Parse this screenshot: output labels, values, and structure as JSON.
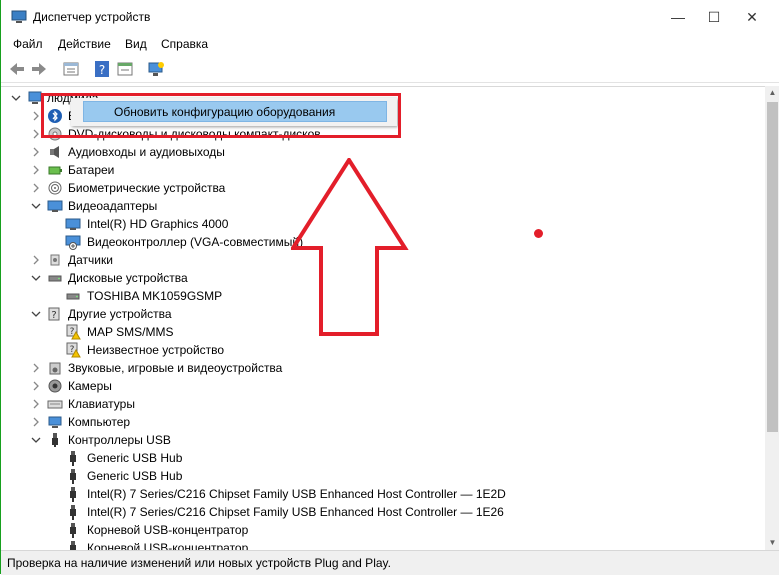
{
  "window": {
    "title": "Диспетчер устройств",
    "controls": {
      "minimize": "—",
      "maximize": "☐",
      "close": "✕"
    }
  },
  "menu": [
    "Файл",
    "Действие",
    "Вид",
    "Справка"
  ],
  "tree": {
    "root": "людмила",
    "items": [
      {
        "label": "Bluetooth",
        "indent": 1,
        "expander": "collapsed",
        "icon": "bluetooth-icon"
      },
      {
        "label": "DVD-дисководы и дисководы компакт-дисков",
        "indent": 1,
        "expander": "collapsed",
        "icon": "dvd-drive-icon"
      },
      {
        "label": "Аудиовходы и аудиовыходы",
        "indent": 1,
        "expander": "collapsed",
        "icon": "audio-icon"
      },
      {
        "label": "Батареи",
        "indent": 1,
        "expander": "collapsed",
        "icon": "battery-icon"
      },
      {
        "label": "Биометрические устройства",
        "indent": 1,
        "expander": "collapsed",
        "icon": "fingerprint-icon"
      },
      {
        "label": "Видеоадаптеры",
        "indent": 1,
        "expander": "expanded",
        "icon": "display-adapter-icon"
      },
      {
        "label": "Intel(R) HD Graphics 4000",
        "indent": 2,
        "expander": "none",
        "icon": "display-adapter-icon"
      },
      {
        "label": "Видеоконтроллер (VGA-совместимый)",
        "indent": 2,
        "expander": "none",
        "icon": "display-adapter-warning-icon"
      },
      {
        "label": "Датчики",
        "indent": 1,
        "expander": "collapsed",
        "icon": "sensor-icon"
      },
      {
        "label": "Дисковые устройства",
        "indent": 1,
        "expander": "expanded",
        "icon": "disk-icon"
      },
      {
        "label": "TOSHIBA MK1059GSMP",
        "indent": 2,
        "expander": "none",
        "icon": "disk-icon"
      },
      {
        "label": "Другие устройства",
        "indent": 1,
        "expander": "expanded",
        "icon": "unknown-device-icon"
      },
      {
        "label": "MAP SMS/MMS",
        "indent": 2,
        "expander": "none",
        "icon": "unknown-device-warning-icon"
      },
      {
        "label": "Неизвестное устройство",
        "indent": 2,
        "expander": "none",
        "icon": "unknown-device-warning-icon"
      },
      {
        "label": "Звуковые, игровые и видеоустройства",
        "indent": 1,
        "expander": "collapsed",
        "icon": "speaker-icon"
      },
      {
        "label": "Камеры",
        "indent": 1,
        "expander": "collapsed",
        "icon": "camera-icon"
      },
      {
        "label": "Клавиатуры",
        "indent": 1,
        "expander": "collapsed",
        "icon": "keyboard-icon"
      },
      {
        "label": "Компьютер",
        "indent": 1,
        "expander": "collapsed",
        "icon": "computer-icon"
      },
      {
        "label": "Контроллеры USB",
        "indent": 1,
        "expander": "expanded",
        "icon": "usb-icon"
      },
      {
        "label": "Generic USB Hub",
        "indent": 2,
        "expander": "none",
        "icon": "usb-plug-icon"
      },
      {
        "label": "Generic USB Hub",
        "indent": 2,
        "expander": "none",
        "icon": "usb-plug-icon"
      },
      {
        "label": "Intel(R) 7 Series/C216 Chipset Family USB Enhanced Host Controller — 1E2D",
        "indent": 2,
        "expander": "none",
        "icon": "usb-plug-icon"
      },
      {
        "label": "Intel(R) 7 Series/C216 Chipset Family USB Enhanced Host Controller — 1E26",
        "indent": 2,
        "expander": "none",
        "icon": "usb-plug-icon"
      },
      {
        "label": "Корневой USB-концентратор",
        "indent": 2,
        "expander": "none",
        "icon": "usb-plug-icon"
      },
      {
        "label": "Корневой USB-концентратор",
        "indent": 2,
        "expander": "none",
        "icon": "usb-plug-icon"
      }
    ]
  },
  "context_menu": {
    "item": "Обновить конфигурацию оборудования"
  },
  "status": "Проверка на наличие изменений или новых устройств Plug and Play.",
  "colors": {
    "highlight": "#e31e2a",
    "menu_hover": "#99c9ef"
  }
}
